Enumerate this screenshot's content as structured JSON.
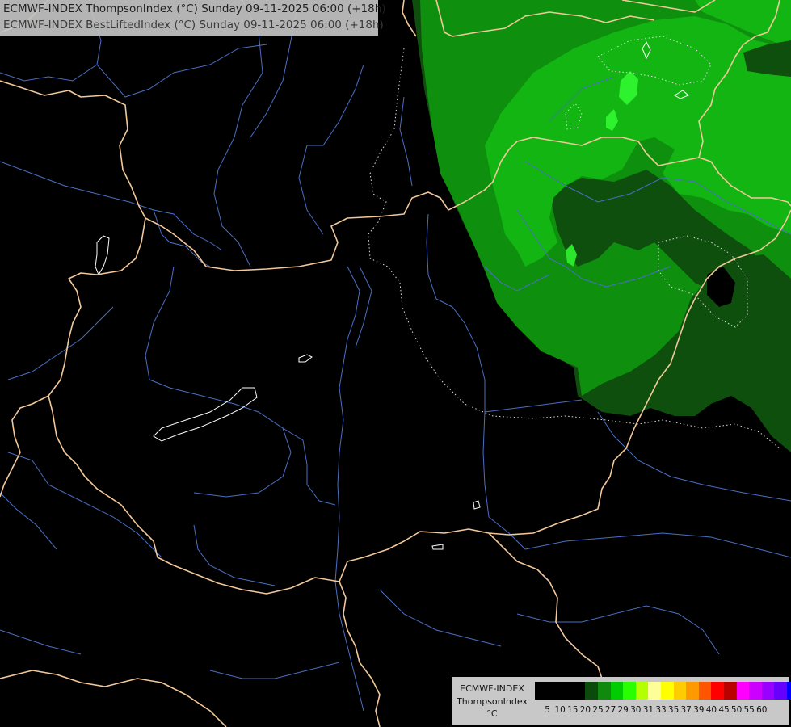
{
  "header": {
    "line1": "ECMWF-INDEX ThompsonIndex (°C) Sunday 09-11-2025 06:00 (+18h)",
    "line2": "ECMWF-INDEX BestLiftedIndex (°C) Sunday 09-11-2025 06:00 (+18h)"
  },
  "legend": {
    "title1": "ECMWF-INDEX",
    "title2": "ThompsonIndex",
    "unit": "°C",
    "colors": [
      "#000000",
      "#000000",
      "#000000",
      "#000000",
      "#0a4a0a",
      "#0f8a0f",
      "#00cc00",
      "#2aff00",
      "#b4ff00",
      "#ffff99",
      "#ffff00",
      "#ffcc00",
      "#ff9900",
      "#ff5500",
      "#ff0000",
      "#bb0000",
      "#ff00ff",
      "#cc00ff",
      "#9900ff",
      "#6600ff",
      "#0000ff"
    ],
    "tick_labels": [
      "5",
      "10",
      "15",
      "20",
      "25",
      "27",
      "29",
      "30",
      "31",
      "33",
      "35",
      "37",
      "39",
      "40",
      "45",
      "50",
      "55",
      "60"
    ]
  },
  "palette": {
    "background": "#000000",
    "border": "#f2c89a",
    "river": "#4a6fc4",
    "zone_dark": "#0e4f0e",
    "zone_mid": "#0d8a0d",
    "zone_light": "#22b322",
    "zone_bright": "#2be62b"
  }
}
